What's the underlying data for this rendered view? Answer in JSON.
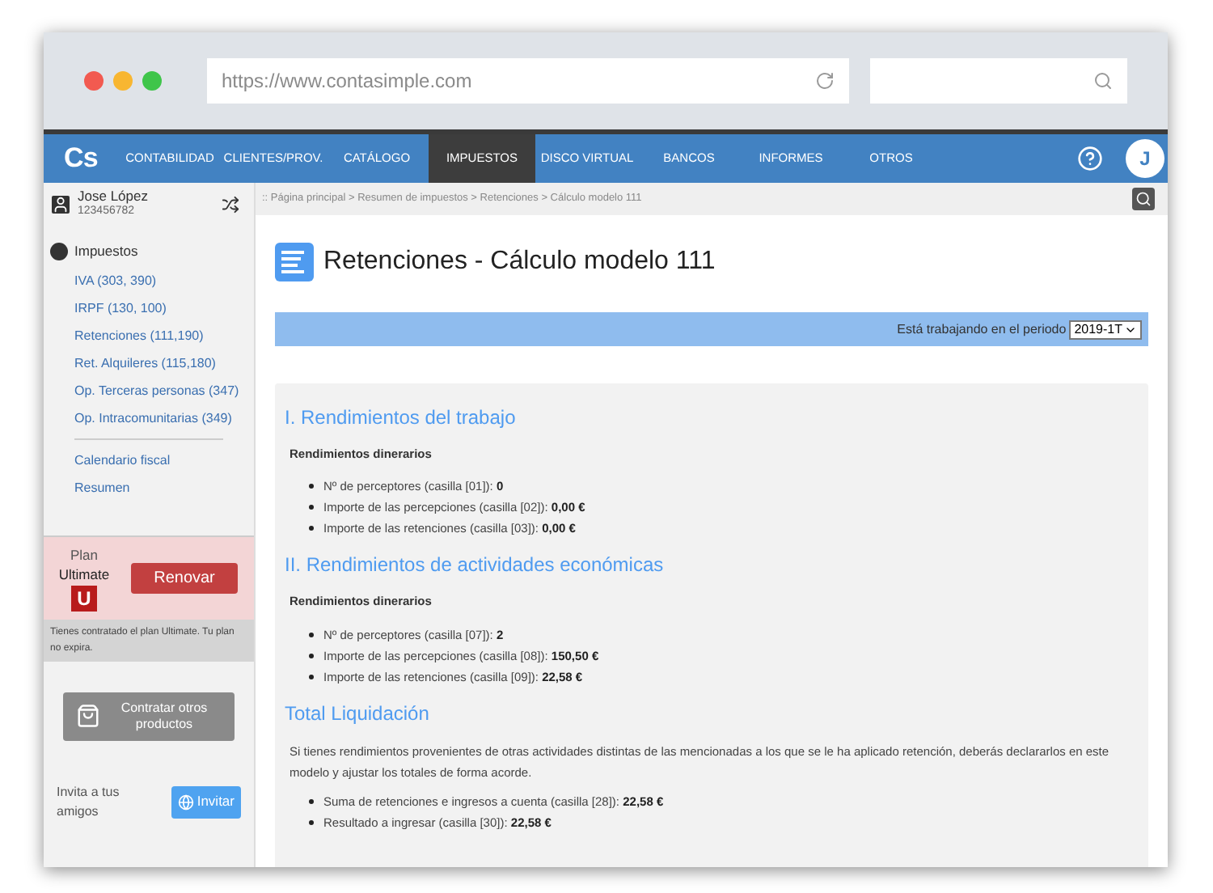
{
  "browser": {
    "url": "https://www.contasimple.com"
  },
  "nav": {
    "logo": "Cs",
    "items": [
      {
        "label": "CONTABILIDAD",
        "selected": false
      },
      {
        "label": "CLIENTES/PROV.",
        "selected": false
      },
      {
        "label": "CATÁLOGO",
        "selected": false
      },
      {
        "label": "IMPUESTOS",
        "selected": true
      },
      {
        "label": "DISCO VIRTUAL",
        "selected": false
      },
      {
        "label": "BANCOS",
        "selected": false
      },
      {
        "label": "INFORMES",
        "selected": false
      },
      {
        "label": "OTROS",
        "selected": false
      }
    ],
    "avatar": "J"
  },
  "user": {
    "name": "Jose López",
    "id": "123456782"
  },
  "sidebar": {
    "section": "Impuestos",
    "items": [
      "IVA (303, 390)",
      "IRPF (130, 100)",
      "Retenciones (111,190)",
      "Ret. Alquileres (115,180)",
      "Op. Terceras personas (347)",
      "Op. Intracomunitarias (349)"
    ],
    "extra_items": [
      "Calendario fiscal",
      "Resumen"
    ]
  },
  "plan": {
    "label": "Plan",
    "name": "Ultimate",
    "badge": "U",
    "button": "Renovar",
    "note": "Tienes contratado el plan Ultimate. Tu plan no expira."
  },
  "products_button": "Contratar otros productos",
  "invite": {
    "text": "Invita a tus amigos",
    "button": "Invitar"
  },
  "breadcrumb": ":: Página principal > Resumen de impuestos > Retenciones > Cálculo modelo 111",
  "page_title": "Retenciones - Cálculo modelo 111",
  "period": {
    "label": "Está trabajando en el periodo",
    "value": "2019-1T"
  },
  "sections": [
    {
      "title": "I. Rendimientos del trabajo",
      "subtitle": "Rendimientos dinerarios",
      "items": [
        {
          "label": "Nº de perceptores (casilla [01]):",
          "value": "0"
        },
        {
          "label": "Importe de las percepciones (casilla [02]):",
          "value": "0,00 €"
        },
        {
          "label": "Importe de las retenciones (casilla [03]):",
          "value": "0,00 €"
        }
      ]
    },
    {
      "title": "II. Rendimientos de actividades económicas",
      "subtitle": "Rendimientos dinerarios",
      "items": [
        {
          "label": "Nº de perceptores (casilla [07]):",
          "value": "2"
        },
        {
          "label": "Importe de las percepciones (casilla [08]):",
          "value": "150,50 €"
        },
        {
          "label": "Importe de las retenciones (casilla [09]):",
          "value": "22,58 €"
        }
      ]
    },
    {
      "title": "Total Liquidación",
      "paragraph": "Si tienes rendimientos provenientes de otras actividades distintas de las mencionadas a los que se le ha aplicado retención, deberás declararlos en este modelo y ajustar los totales de forma acorde.",
      "items": [
        {
          "label": "Suma de retenciones e ingresos a cuenta (casilla [28]):",
          "value": "22,58 €"
        },
        {
          "label": "Resultado a ingresar (casilla [30]):",
          "value": "22,58 €"
        }
      ]
    }
  ]
}
